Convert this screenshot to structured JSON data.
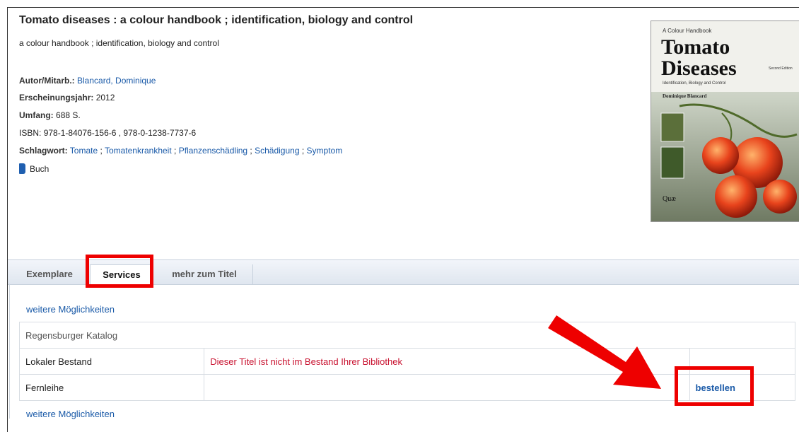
{
  "record": {
    "title": "Tomato diseases :  a colour handbook ; identification, biology and control",
    "subtitle": "a colour handbook ; identification, biology and control",
    "author_label": "Autor/Mitarb.:",
    "author": "Blancard, Dominique",
    "year_label": "Erscheinungsjahr:",
    "year": "2012",
    "extent_label": "Umfang:",
    "extent": "688 S.",
    "isbn_label": "ISBN:",
    "isbn": "978-1-84076-156-6 , 978-0-1238-7737-6",
    "subject_label": "Schlagwort:",
    "subjects": [
      "Tomate",
      "Tomatenkrankheit",
      "Pflanzenschädling",
      "Schädigung",
      "Symptom"
    ],
    "subject_sep": " ; ",
    "type_label": "Buch"
  },
  "cover": {
    "top_line": "A Colour Handbook",
    "big1": "Tomato",
    "big2": "Diseases",
    "edition": "Second Edition",
    "sub": "Identification, Biology and Control",
    "author": "Dominique Blancard",
    "publisher": "Quæ"
  },
  "tabs": [
    {
      "label": "Exemplare"
    },
    {
      "label": "Services"
    },
    {
      "label": "mehr zum Titel"
    }
  ],
  "services": {
    "more_top": "weitere Möglichkeiten",
    "catalog_header": "Regensburger Katalog",
    "rows": [
      {
        "label": "Lokaler Bestand",
        "info": "Dieser Titel ist nicht im Bestand Ihrer Bibliothek",
        "action": ""
      },
      {
        "label": "Fernleihe",
        "info": "",
        "action": "bestellen"
      }
    ],
    "more_bottom": "weitere Möglichkeiten"
  },
  "colors": {
    "highlight": "#ee0000",
    "link": "#1a5aa8",
    "warning": "#c8102e"
  }
}
